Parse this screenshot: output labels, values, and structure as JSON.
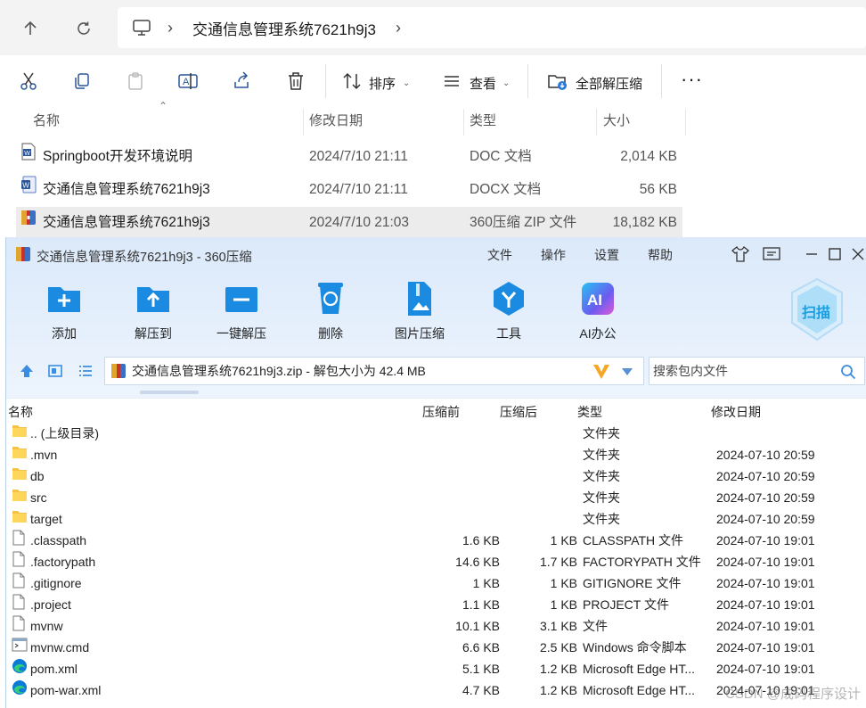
{
  "explorer": {
    "breadcrumb": "交通信息管理系统7621h9j3",
    "toolbar": {
      "sort_label": "排序",
      "view_label": "查看",
      "extract_all_label": "全部解压缩"
    },
    "columns": [
      "名称",
      "修改日期",
      "类型",
      "大小"
    ],
    "files": [
      {
        "name": "Springboot开发环境说明",
        "date": "2024/7/10 21:11",
        "type": "DOC 文档",
        "size": "2,014 KB",
        "icon": "word-doc-icon"
      },
      {
        "name": "交通信息管理系统7621h9j3",
        "date": "2024/7/10 21:11",
        "type": "DOCX 文档",
        "size": "56 KB",
        "icon": "word-docx-icon"
      },
      {
        "name": "交通信息管理系统7621h9j3",
        "date": "2024/7/10 21:03",
        "type": "360压缩 ZIP 文件",
        "size": "18,182 KB",
        "icon": "zip-archive-icon"
      }
    ]
  },
  "zip": {
    "title": "交通信息管理系统7621h9j3 - 360压缩",
    "menu": [
      "文件",
      "操作",
      "设置",
      "帮助"
    ],
    "tools": [
      {
        "label": "添加",
        "icon": "add-folder-icon"
      },
      {
        "label": "解压到",
        "icon": "extract-to-icon"
      },
      {
        "label": "一键解压",
        "icon": "one-click-extract-icon"
      },
      {
        "label": "删除",
        "icon": "recycle-icon"
      },
      {
        "label": "图片压缩",
        "icon": "image-compress-icon"
      },
      {
        "label": "工具",
        "icon": "tools-icon"
      },
      {
        "label": "AI办公",
        "icon": "ai-office-icon"
      }
    ],
    "scan_label": "扫描",
    "path_text": "交通信息管理系统7621h9j3.zip - 解包大小为 42.4 MB",
    "search_placeholder": "搜索包内文件",
    "columns": [
      "名称",
      "压缩前",
      "压缩后",
      "类型",
      "修改日期"
    ],
    "rows": [
      {
        "name": ".. (上级目录)",
        "before": "",
        "after": "",
        "type": "文件夹",
        "date": "",
        "icon": "folder-icon"
      },
      {
        "name": ".mvn",
        "before": "",
        "after": "",
        "type": "文件夹",
        "date": "2024-07-10 20:59",
        "icon": "folder-icon"
      },
      {
        "name": "db",
        "before": "",
        "after": "",
        "type": "文件夹",
        "date": "2024-07-10 20:59",
        "icon": "folder-icon"
      },
      {
        "name": "src",
        "before": "",
        "after": "",
        "type": "文件夹",
        "date": "2024-07-10 20:59",
        "icon": "folder-icon"
      },
      {
        "name": "target",
        "before": "",
        "after": "",
        "type": "文件夹",
        "date": "2024-07-10 20:59",
        "icon": "folder-icon"
      },
      {
        "name": ".classpath",
        "before": "1.6 KB",
        "after": "1 KB",
        "type": "CLASSPATH 文件",
        "date": "2024-07-10 19:01",
        "icon": "file-icon"
      },
      {
        "name": ".factorypath",
        "before": "14.6 KB",
        "after": "1.7 KB",
        "type": "FACTORYPATH 文件",
        "date": "2024-07-10 19:01",
        "icon": "file-icon"
      },
      {
        "name": ".gitignore",
        "before": "1 KB",
        "after": "1 KB",
        "type": "GITIGNORE 文件",
        "date": "2024-07-10 19:01",
        "icon": "file-icon"
      },
      {
        "name": ".project",
        "before": "1.1 KB",
        "after": "1 KB",
        "type": "PROJECT 文件",
        "date": "2024-07-10 19:01",
        "icon": "file-icon"
      },
      {
        "name": "mvnw",
        "before": "10.1 KB",
        "after": "3.1 KB",
        "type": "文件",
        "date": "2024-07-10 19:01",
        "icon": "file-icon"
      },
      {
        "name": "mvnw.cmd",
        "before": "6.6 KB",
        "after": "2.5 KB",
        "type": "Windows 命令脚本",
        "date": "2024-07-10 19:01",
        "icon": "cmd-script-icon"
      },
      {
        "name": "pom.xml",
        "before": "5.1 KB",
        "after": "1.2 KB",
        "type": "Microsoft Edge HT...",
        "date": "2024-07-10 19:01",
        "icon": "edge-icon"
      },
      {
        "name": "pom-war.xml",
        "before": "4.7 KB",
        "after": "1.2 KB",
        "type": "Microsoft Edge HT...",
        "date": "2024-07-10 19:01",
        "icon": "edge-icon"
      }
    ]
  },
  "watermark": "CSDN @成码程序设计"
}
